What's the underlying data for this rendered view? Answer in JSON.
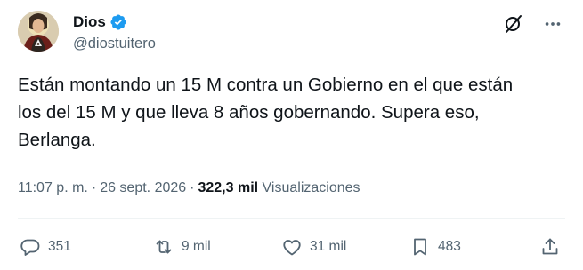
{
  "author": {
    "display_name": "Dios",
    "handle": "@diostuitero",
    "verified": true
  },
  "tweet": {
    "text": "Están montando un 15 M contra un Gobierno en el que están\nlos del 15 M y que lleva 8 años gobernando. Supera eso,\nBerlanga.",
    "time": "11:07 p. m.",
    "separator": "·",
    "date": "26 sept. 2026",
    "views_count": "322,3 mil",
    "views_label": "Visualizaciones"
  },
  "actions": {
    "replies": "351",
    "reposts": "9 mil",
    "likes": "31 mil",
    "bookmarks": "483"
  },
  "colors": {
    "text": "#0f1419",
    "secondary": "#536471",
    "verified_blue": "#1d9bf0",
    "divider": "#eff3f4"
  },
  "icons": {
    "header": [
      "grok-icon",
      "more-icon"
    ],
    "actions": [
      "reply-icon",
      "repost-icon",
      "like-icon",
      "bookmark-icon",
      "share-icon"
    ]
  }
}
